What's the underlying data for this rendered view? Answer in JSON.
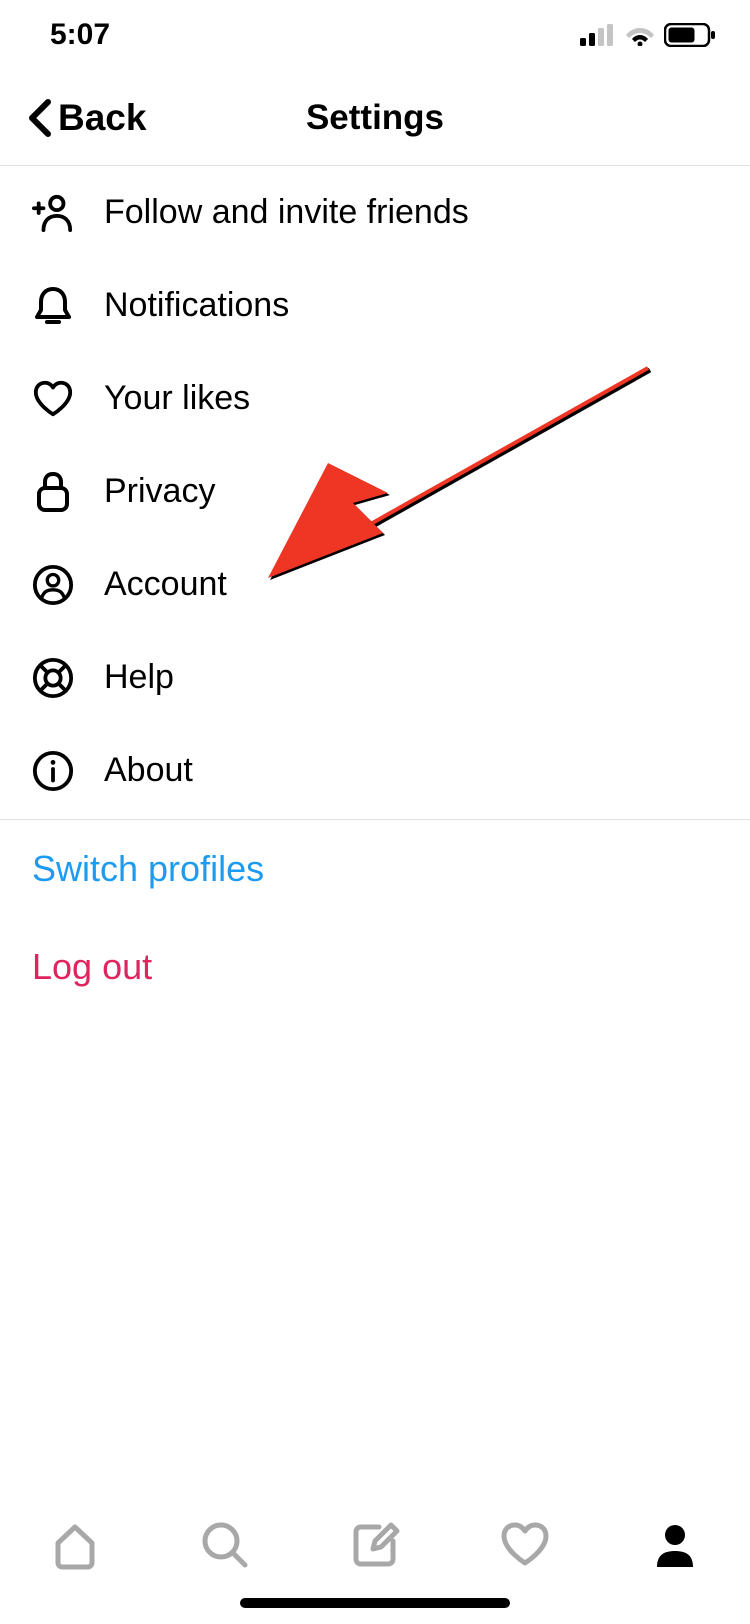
{
  "status_bar": {
    "time": "5:07"
  },
  "header": {
    "back_label": "Back",
    "title": "Settings"
  },
  "menu": {
    "items": [
      {
        "id": "follow-invite",
        "label": "Follow and invite friends"
      },
      {
        "id": "notifications",
        "label": "Notifications"
      },
      {
        "id": "your-likes",
        "label": "Your likes"
      },
      {
        "id": "privacy",
        "label": "Privacy"
      },
      {
        "id": "account",
        "label": "Account"
      },
      {
        "id": "help",
        "label": "Help"
      },
      {
        "id": "about",
        "label": "About"
      }
    ]
  },
  "actions": {
    "switch_profiles": "Switch profiles",
    "log_out": "Log out"
  },
  "colors": {
    "link_blue": "#1d9bf0",
    "destructive_red": "#e0245e",
    "arrow_red": "#ef3524"
  }
}
